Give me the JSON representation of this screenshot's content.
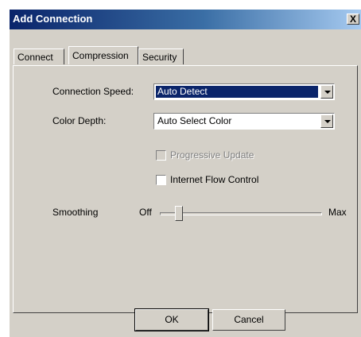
{
  "window": {
    "title": "Add Connection",
    "close_glyph": "X"
  },
  "tabs": [
    {
      "label": "Connect",
      "active": false
    },
    {
      "label": "Compression",
      "active": true
    },
    {
      "label": "Security",
      "active": false
    }
  ],
  "connection_speed": {
    "label": "Connection Speed:",
    "value": "Auto Detect"
  },
  "color_depth": {
    "label": "Color Depth:",
    "value": "Auto Select Color"
  },
  "progressive_update": {
    "label": "Progressive Update",
    "checked": false,
    "enabled": false
  },
  "internet_flow_control": {
    "label": "Internet Flow Control",
    "checked": false,
    "enabled": true
  },
  "smoothing": {
    "label": "Smoothing",
    "min_label": "Off",
    "max_label": "Max",
    "level": 0.1
  },
  "buttons": {
    "ok": "OK",
    "cancel": "Cancel"
  },
  "colors": {
    "titlebar_start": "#0a246a",
    "titlebar_end": "#a6caf0",
    "dialog_bg": "#d4d0c8",
    "selection": "#0a246a"
  }
}
